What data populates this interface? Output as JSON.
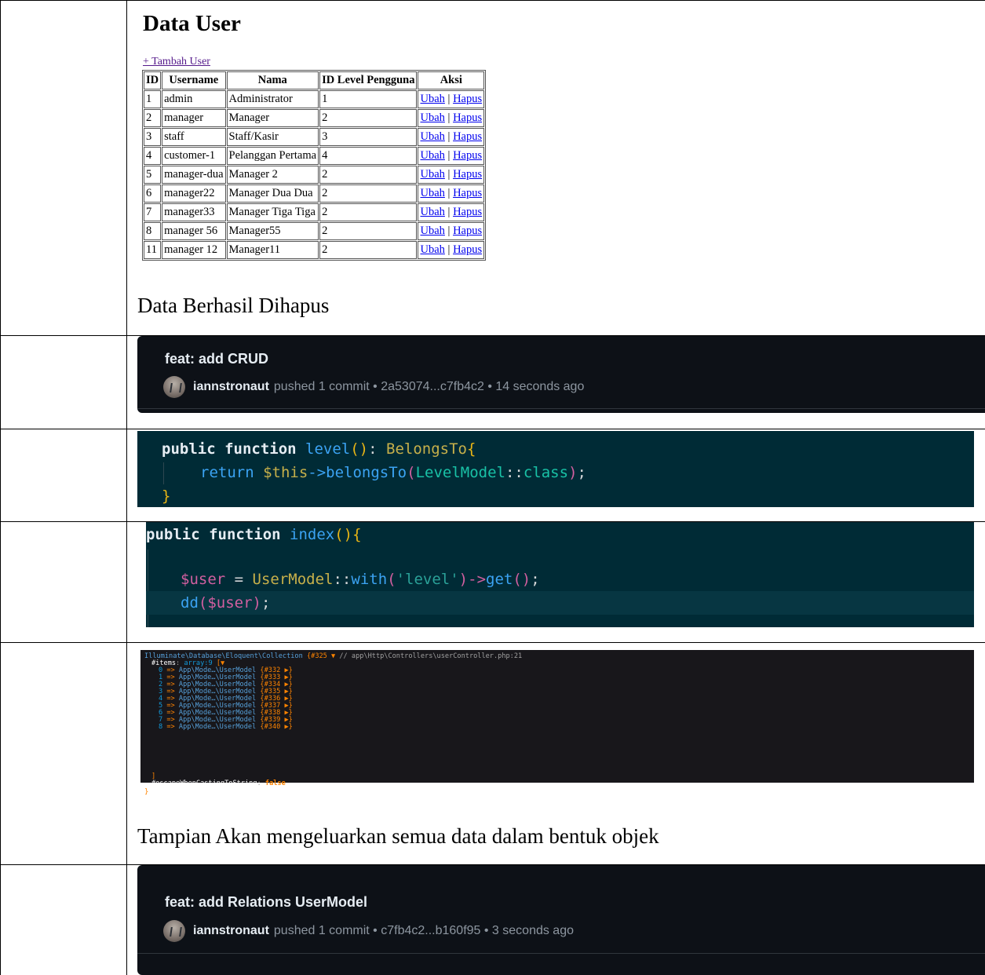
{
  "page": {
    "title": "Data User",
    "add_link": "+ Tambah User",
    "table": {
      "headers": [
        "ID",
        "Username",
        "Nama",
        "ID Level Pengguna",
        "Aksi"
      ],
      "rows": [
        {
          "id": "1",
          "username": "admin",
          "nama": "Administrator",
          "level": "1"
        },
        {
          "id": "2",
          "username": "manager",
          "nama": "Manager",
          "level": "2"
        },
        {
          "id": "3",
          "username": "staff",
          "nama": "Staff/Kasir",
          "level": "3"
        },
        {
          "id": "4",
          "username": "customer-1",
          "nama": "Pelanggan Pertama",
          "level": "4"
        },
        {
          "id": "5",
          "username": "manager-dua",
          "nama": "Manager 2",
          "level": "2"
        },
        {
          "id": "6",
          "username": "manager22",
          "nama": "Manager Dua Dua",
          "level": "2"
        },
        {
          "id": "7",
          "username": "manager33",
          "nama": "Manager Tiga Tiga",
          "level": "2"
        },
        {
          "id": "8",
          "username": "manager 56",
          "nama": "Manager55",
          "level": "2"
        },
        {
          "id": "11",
          "username": "manager 12",
          "nama": "Manager11",
          "level": "2"
        }
      ],
      "edit_label": "Ubah",
      "separator": "|",
      "delete_label": "Hapus"
    }
  },
  "notes": {
    "deleted": "Data Berhasil Dihapus",
    "object_output": "Tampian Akan mengeluarkan semua data dalam bentuk objek"
  },
  "commit_1": {
    "title": "feat: add CRUD",
    "user": "iannstronaut",
    "details": "pushed 1 commit • 2a53074...c7fb4c2 • 14 seconds ago"
  },
  "commit_2": {
    "title": "feat: add Relations UserModel",
    "user": "iannstronaut",
    "details": "pushed 1 commit • c7fb4c2...b160f95 • 3 seconds ago"
  },
  "code_1": {
    "l1_kw": "public function ",
    "l1_fn": "level",
    "l1_paren": "()",
    "l1_colon": ": ",
    "l1_type": "BelongsTo",
    "l1_brace": "{",
    "l2_kw": "return ",
    "l2_var": "$this",
    "l2_arrow": "->",
    "l2_fn": "belongsTo",
    "l2_open": "(",
    "l2_cls": "LevelModel",
    "l2_sep": "::",
    "l2_const": "class",
    "l2_close": ")",
    "l2_semi": ";",
    "l3_brace": "}"
  },
  "code_2": {
    "l1_kw": "public function ",
    "l1_fn": "index",
    "l1_paren": "(){",
    "l2_var": "$user",
    "l2_eq": " = ",
    "l2_cls": "UserModel",
    "l2_sep": "::",
    "l2_fn": "with",
    "l2_open": "(",
    "l2_str": "'level'",
    "l2_close": ")",
    "l2_arrow": "->",
    "l2_get": "get",
    "l2_paren": "()",
    "l2_semi": ";",
    "l3_fn": "dd",
    "l3_open": "(",
    "l3_var": "$user",
    "l3_close": ")",
    "l3_semi": ";"
  },
  "dump": {
    "class": "Illuminate\\Database\\Eloquent\\Collection",
    "ref": "{#325 ▼",
    "comment": "// app\\Http\\Controllers\\userController.php:21",
    "items_key": "#items",
    "items_type": "array:9",
    "items_open": "[▼",
    "items": [
      {
        "index": "0",
        "class": "App\\Mode…\\UserModel",
        "ref": "{#332 ▶}"
      },
      {
        "index": "1",
        "class": "App\\Mode…\\UserModel",
        "ref": "{#333 ▶}"
      },
      {
        "index": "2",
        "class": "App\\Mode…\\UserModel",
        "ref": "{#334 ▶}"
      },
      {
        "index": "3",
        "class": "App\\Mode…\\UserModel",
        "ref": "{#335 ▶}"
      },
      {
        "index": "4",
        "class": "App\\Mode…\\UserModel",
        "ref": "{#336 ▶}"
      },
      {
        "index": "5",
        "class": "App\\Mode…\\UserModel",
        "ref": "{#337 ▶}"
      },
      {
        "index": "6",
        "class": "App\\Mode…\\UserModel",
        "ref": "{#338 ▶}"
      },
      {
        "index": "7",
        "class": "App\\Mode…\\UserModel",
        "ref": "{#339 ▶}"
      },
      {
        "index": "8",
        "class": "App\\Mode…\\UserModel",
        "ref": "{#340 ▶}"
      }
    ],
    "arrow": "=>",
    "items_close": "]",
    "escape_key": "#escapeWhenCastingToString",
    "escape_value": "false",
    "close": "}"
  }
}
